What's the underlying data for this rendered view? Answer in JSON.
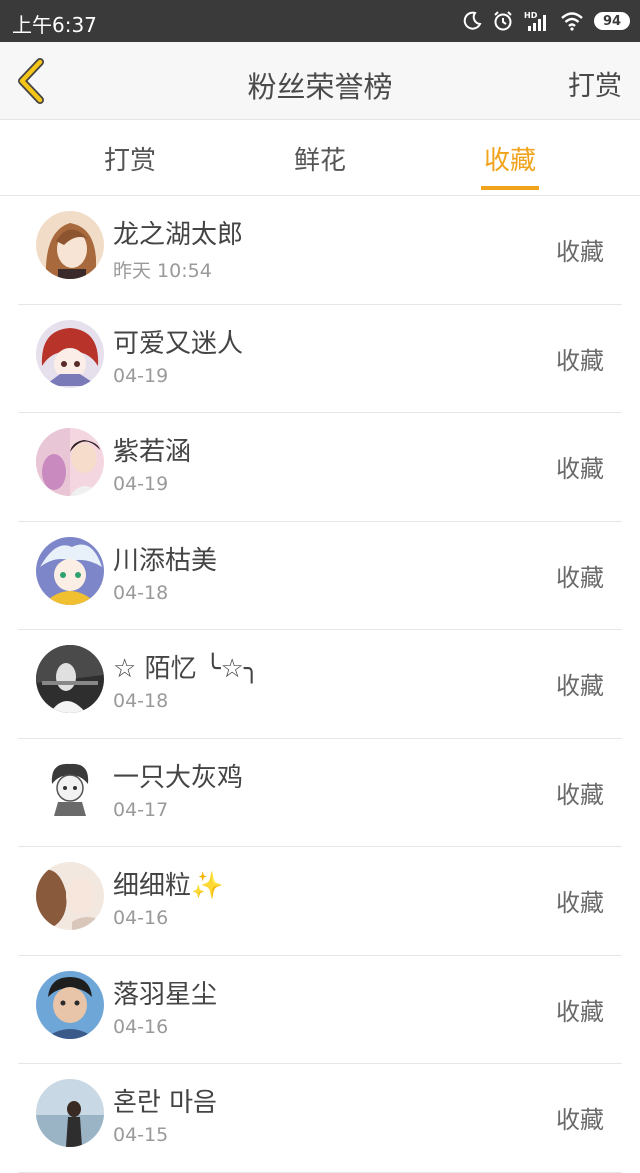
{
  "status_bar": {
    "time": "上午6:37",
    "battery": "94",
    "icons": [
      "moon-icon",
      "alarm-icon",
      "hd-signal-icon",
      "wifi-icon",
      "battery-icon"
    ]
  },
  "header": {
    "back_icon": "chevron-left-icon",
    "title": "粉丝荣誉榜",
    "right_button": "打赏"
  },
  "tabs": [
    {
      "label": "打赏",
      "active": false
    },
    {
      "label": "鲜花",
      "active": false
    },
    {
      "label": "收藏",
      "active": true
    }
  ],
  "accent_color": "#f2a31c",
  "fans": [
    {
      "name": "龙之湖太郎",
      "date": "昨天 10:54",
      "action": "收藏"
    },
    {
      "name": "可爱又迷人",
      "date": "04-19",
      "action": "收藏"
    },
    {
      "name": "紫若涵",
      "date": "04-19",
      "action": "收藏"
    },
    {
      "name": "川添枯美",
      "date": "04-18",
      "action": "收藏"
    },
    {
      "name": "☆ 陌忆 ╰☆╮",
      "date": "04-18",
      "action": "收藏"
    },
    {
      "name": "一只大灰鸡",
      "date": "04-17",
      "action": "收藏"
    },
    {
      "name": "细细粒✨",
      "date": "04-16",
      "action": "收藏"
    },
    {
      "name": "落羽星尘",
      "date": "04-16",
      "action": "收藏"
    },
    {
      "name": "혼란 마음",
      "date": "04-15",
      "action": "收藏"
    }
  ]
}
